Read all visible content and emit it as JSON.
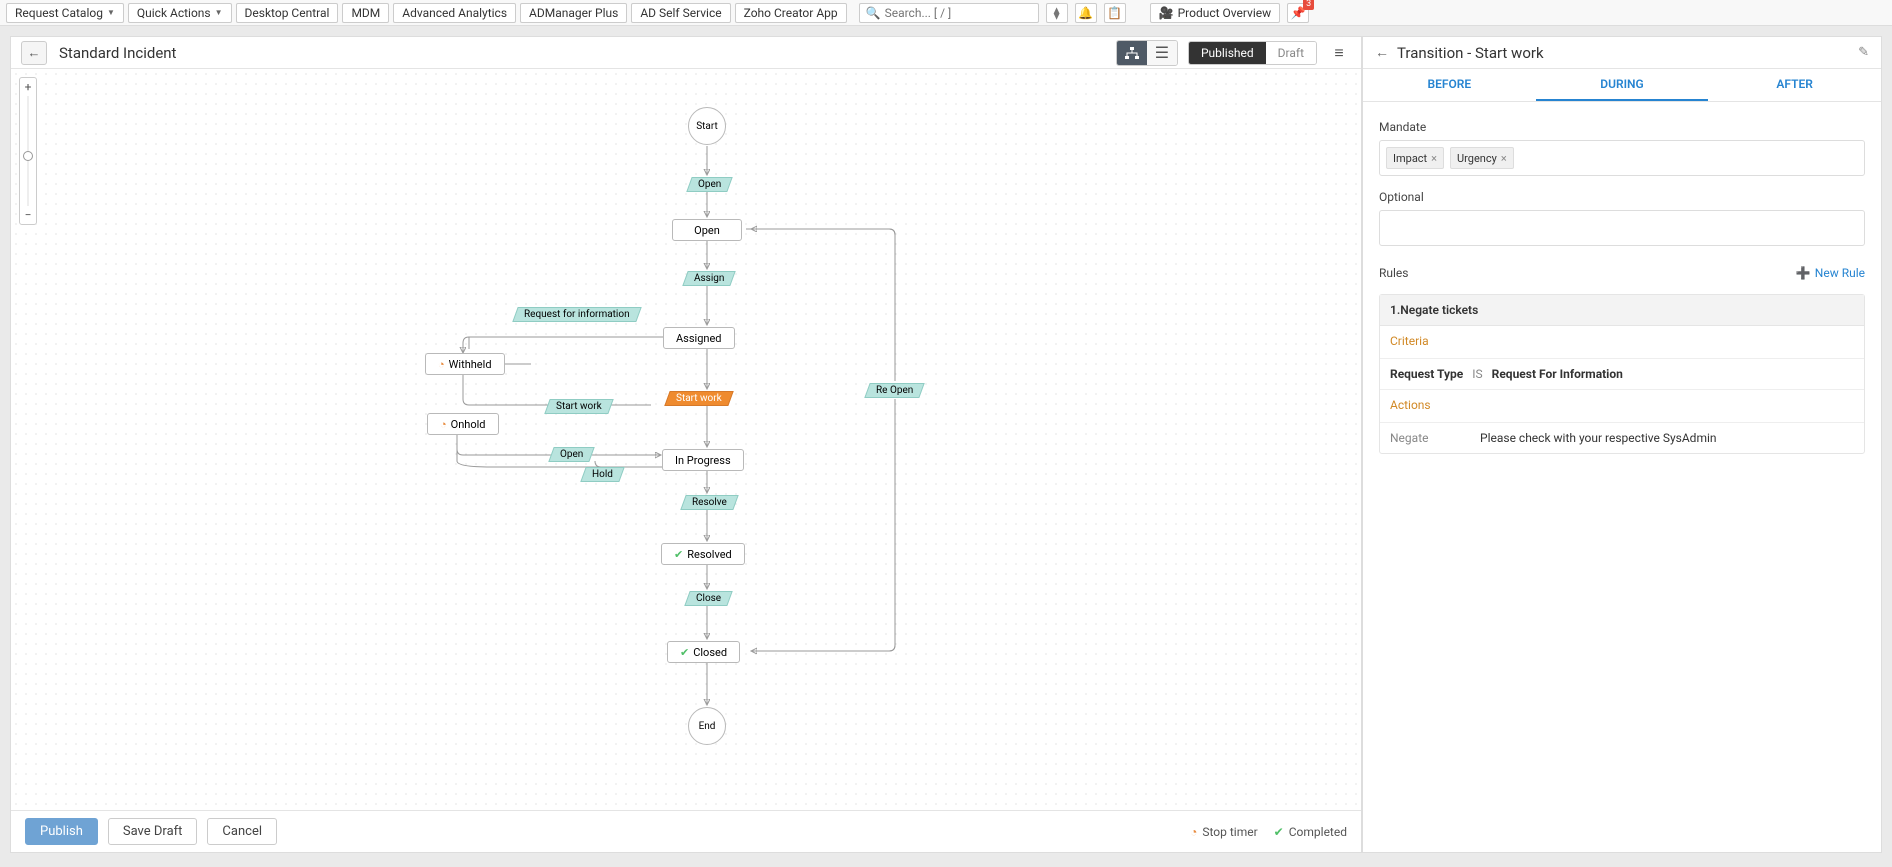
{
  "topbar": {
    "request_catalog": "Request Catalog",
    "quick_actions": "Quick Actions",
    "links": [
      "Desktop Central",
      "MDM",
      "Advanced Analytics",
      "ADManager Plus",
      "AD Self Service",
      "Zoho Creator App"
    ],
    "search_placeholder": "Search... [ / ]",
    "product_overview": "Product Overview",
    "pin_badge": "3"
  },
  "canvas": {
    "title": "Standard Incident",
    "status_published": "Published",
    "status_draft": "Draft",
    "start": "Start",
    "end": "End",
    "states": {
      "open": "Open",
      "assigned": "Assigned",
      "withheld": "Withheld",
      "onhold": "Onhold",
      "inprogress": "In Progress",
      "resolved": "Resolved",
      "closed": "Closed"
    },
    "transitions": {
      "open_t": "Open",
      "assign": "Assign",
      "rfi": "Request for information",
      "startwork_sel": "Start work",
      "startwork": "Start work",
      "reopen": "Re Open",
      "open_t2": "Open",
      "hold": "Hold",
      "resolve": "Resolve",
      "close": "Close"
    }
  },
  "footer": {
    "publish": "Publish",
    "save_draft": "Save Draft",
    "cancel": "Cancel",
    "stop_timer": "Stop timer",
    "completed": "Completed"
  },
  "panel": {
    "title": "Transition - Start work",
    "tabs": {
      "before": "BEFORE",
      "during": "DURING",
      "after": "AFTER"
    },
    "mandate_label": "Mandate",
    "tags": {
      "impact": "Impact",
      "urgency": "Urgency"
    },
    "optional_label": "Optional",
    "rules_label": "Rules",
    "new_rule": "New Rule",
    "rule_title": "1.Negate tickets",
    "criteria_label": "Criteria",
    "criteria_field": "Request Type",
    "criteria_op": "IS",
    "criteria_value": "Request For Information",
    "actions_label": "Actions",
    "action_key": "Negate",
    "action_msg": "Please check with your respective SysAdmin"
  }
}
